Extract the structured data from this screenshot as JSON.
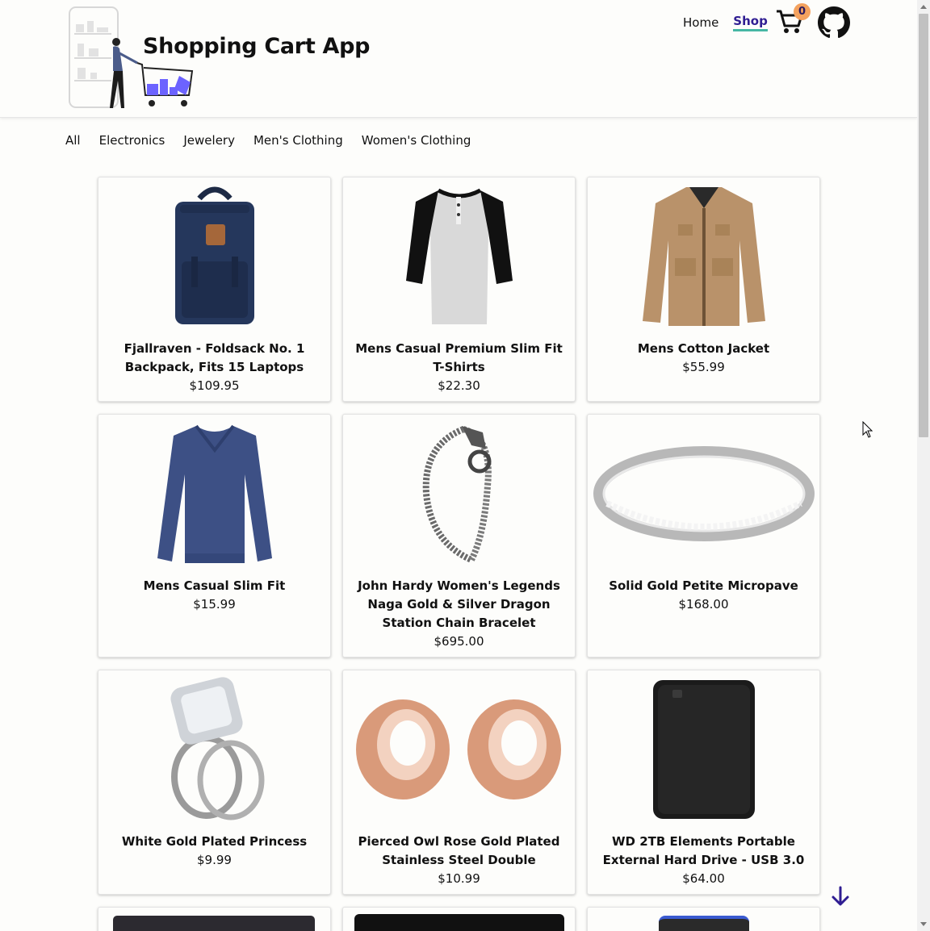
{
  "header": {
    "app_title": "Shopping Cart App",
    "nav": [
      {
        "label": "Home",
        "active": false
      },
      {
        "label": "Shop",
        "active": true
      }
    ],
    "cart_count": "0",
    "accent_color": "#2f1d92",
    "underline_color": "#46b7a4",
    "badge_color": "#f4a25f"
  },
  "categories": [
    "All",
    "Electronics",
    "Jewelery",
    "Men's Clothing",
    "Women's Clothing"
  ],
  "products": [
    {
      "title": "Fjallraven - Foldsack No. 1 Backpack, Fits 15 Laptops",
      "price": "$109.95",
      "icon": "backpack-image"
    },
    {
      "title": "Mens Casual Premium Slim Fit T-Shirts",
      "price": "$22.30",
      "icon": "tshirt-image"
    },
    {
      "title": "Mens Cotton Jacket",
      "price": "$55.99",
      "icon": "jacket-image"
    },
    {
      "title": "Mens Casual Slim Fit",
      "price": "$15.99",
      "icon": "sweater-image"
    },
    {
      "title": "John Hardy Women's Legends Naga Gold & Silver Dragon Station Chain Bracelet",
      "price": "$695.00",
      "icon": "bracelet-image"
    },
    {
      "title": "Solid Gold Petite Micropave",
      "price": "$168.00",
      "icon": "ring-band-image"
    },
    {
      "title": "White Gold Plated Princess",
      "price": "$9.99",
      "icon": "diamond-ring-image"
    },
    {
      "title": "Pierced Owl Rose Gold Plated Stainless Steel Double",
      "price": "$10.99",
      "icon": "rose-gold-plugs-image"
    },
    {
      "title": "WD 2TB Elements Portable External Hard Drive - USB 3.0",
      "price": "$64.00",
      "icon": "hard-drive-image"
    }
  ]
}
